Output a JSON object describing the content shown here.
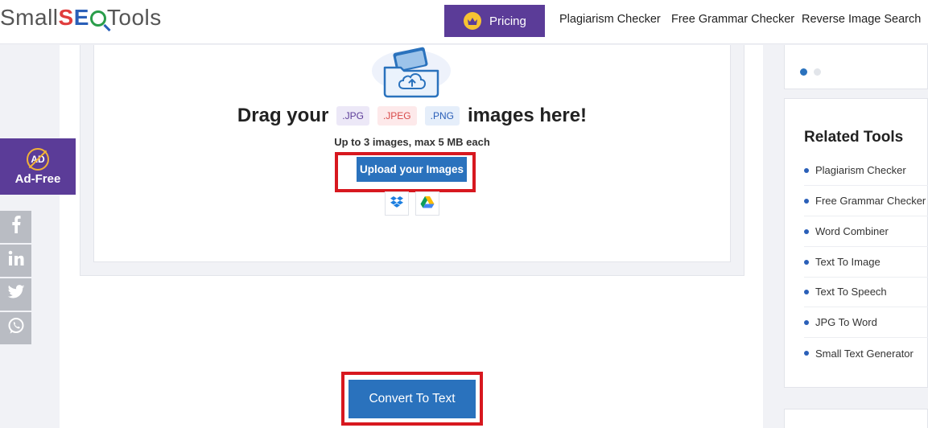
{
  "header": {
    "logo": {
      "part1": "Small",
      "s": "S",
      "e": "E",
      "part2": "Tools"
    },
    "pricing_label": "Pricing",
    "nav": [
      {
        "label": "Plagiarism Checker"
      },
      {
        "label": "Free Grammar Checker"
      },
      {
        "label": "Reverse Image Search"
      }
    ]
  },
  "sidebar": {
    "adfree_icon_text": "AD",
    "adfree_label": "Ad-Free",
    "social_icons": [
      "facebook-icon",
      "linkedin-icon",
      "twitter-icon",
      "whatsapp-icon"
    ]
  },
  "upload": {
    "drag_prefix": "Drag your",
    "formats": [
      ".JPG",
      ".JPEG",
      ".PNG"
    ],
    "drag_suffix": "images here!",
    "limit_text": "Up to 3 images, max 5 MB each",
    "upload_button": "Upload your Images",
    "cloud_sources": [
      "dropbox-icon",
      "google-drive-icon"
    ]
  },
  "convert_button": "Convert To Text",
  "related": {
    "title": "Related Tools",
    "items": [
      {
        "label": "Plagiarism Checker"
      },
      {
        "label": "Free Grammar Checker"
      },
      {
        "label": "Word Combiner"
      },
      {
        "label": "Text To Image"
      },
      {
        "label": "Text To Speech"
      },
      {
        "label": "JPG To Word"
      },
      {
        "label": "Small Text Generator"
      }
    ]
  },
  "colors": {
    "brand_purple": "#5b3c98",
    "button_blue": "#2a72bd",
    "highlight_red": "#d7181f"
  }
}
